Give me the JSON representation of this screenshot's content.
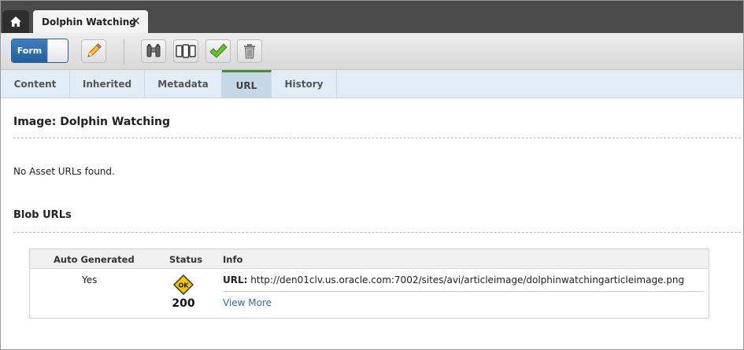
{
  "top_tabs": {
    "home_icon": "home-icon",
    "document_tab": {
      "label": "Dolphin Watching",
      "close_icon": "close-icon"
    }
  },
  "toolbar": {
    "form_toggle_label": "Form",
    "buttons": [
      {
        "name": "edit",
        "icon": "pencil-icon"
      },
      {
        "name": "search",
        "icon": "binoculars-icon"
      },
      {
        "name": "preview-devices",
        "icon": "devices-icon"
      },
      {
        "name": "approve",
        "icon": "checkmark-icon"
      },
      {
        "name": "delete",
        "icon": "trash-icon"
      }
    ]
  },
  "tabs": [
    {
      "label": "Content",
      "active": false
    },
    {
      "label": "Inherited",
      "active": false
    },
    {
      "label": "Metadata",
      "active": false
    },
    {
      "label": "URL",
      "active": true
    },
    {
      "label": "History",
      "active": false
    }
  ],
  "main": {
    "title": "Image: Dolphin Watching",
    "no_asset_urls": "No Asset URLs found.",
    "blob_section_title": "Blob URLs",
    "blob_table": {
      "headers": [
        "Auto Generated",
        "Status",
        "Info"
      ],
      "rows": [
        {
          "auto_generated": "Yes",
          "status_badge": "OK",
          "status_code": "200",
          "url_label": "URL:",
          "url": "http://den01clv.us.oracle.com:7002/sites/avi/articleimage/dolphinwatchingarticleimage.png",
          "view_more": "View More"
        }
      ]
    }
  },
  "colors": {
    "accent_blue": "#2a6fad",
    "active_tab_green": "#4a8a3c",
    "status_ok_yellow": "#f5c400"
  }
}
